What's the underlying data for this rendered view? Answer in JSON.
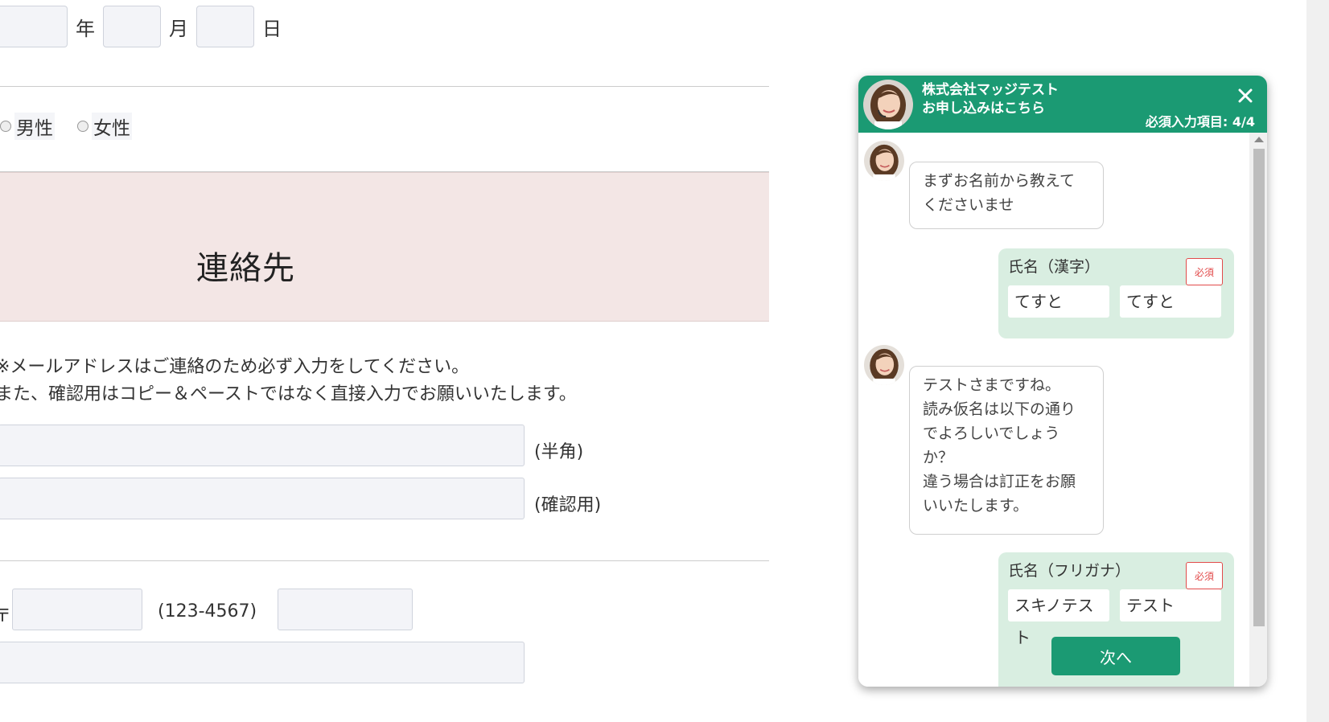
{
  "form": {
    "date_units": {
      "year": "年",
      "month": "月",
      "day": "日"
    },
    "gender": {
      "male": "男性",
      "female": "女性"
    },
    "section_title": "連絡先",
    "email_note": [
      "※メールアドレスはご連絡のため必ず入力をしてください。",
      "また、確認用はコピー＆ペーストではなく直接入力でお願いいたします。"
    ],
    "email_suffix": "(半角)",
    "email_confirm_suffix": "(確認用)",
    "postal_prefix": "〒",
    "postal_hint": "(123-4567)"
  },
  "chat": {
    "company": "株式会社マッジテスト",
    "subtitle": "お申し込みはこちら",
    "progress": "必須入力項目: 4/4",
    "colors": {
      "brand": "#1b9a73",
      "card": "#d9eee1",
      "required": "#e24b4b"
    },
    "messages": {
      "m1": [
        "まずお名前から教えて",
        "くださいませ"
      ],
      "m2": [
        "テストさまですね。",
        "読み仮名は以下の通り",
        "でよろしいでしょう",
        "か？",
        "違う場合は訂正をお願",
        "いいたします。"
      ]
    },
    "name_kanji": {
      "label": "氏名（漢字）",
      "required": "必須",
      "last": "てすと",
      "first": "てすと"
    },
    "name_kana": {
      "label": "氏名（フリガナ）",
      "required": "必須",
      "last": "スキノテスト",
      "first": "テスト"
    },
    "next_button": "次へ"
  }
}
